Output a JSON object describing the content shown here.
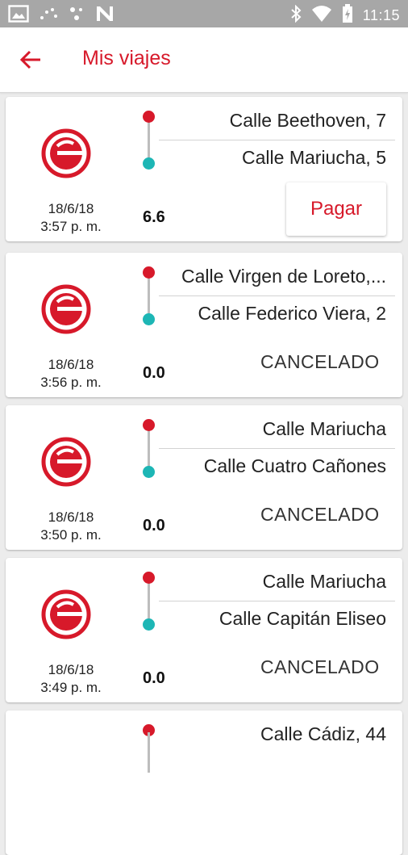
{
  "status_bar": {
    "time": "11:15"
  },
  "app_bar": {
    "title": "Mis viajes"
  },
  "trips": [
    {
      "date": "18/6/18",
      "time": "3:57 p. m.",
      "origin": "Calle Beethoven, 7",
      "destination": "Calle Mariucha, 5",
      "amount": "6.6",
      "action": "Pagar"
    },
    {
      "date": "18/6/18",
      "time": "3:56 p. m.",
      "origin": "Calle Virgen de Loreto,...",
      "destination": "Calle Federico Viera, 2",
      "amount": "0.0",
      "status": "CANCELADO"
    },
    {
      "date": "18/6/18",
      "time": "3:50 p. m.",
      "origin": "Calle Mariucha",
      "destination": "Calle Cuatro Cañones",
      "amount": "0.0",
      "status": "CANCELADO"
    },
    {
      "date": "18/6/18",
      "time": "3:49 p. m.",
      "origin": "Calle Mariucha",
      "destination": "Calle Capitán Eliseo",
      "amount": "0.0",
      "status": "CANCELADO"
    },
    {
      "origin": "Calle Cádiz, 44"
    }
  ],
  "colors": {
    "brand_red": "#d7192a",
    "destination_teal": "#1db6b5",
    "status_bar": "#a7a7a7"
  }
}
